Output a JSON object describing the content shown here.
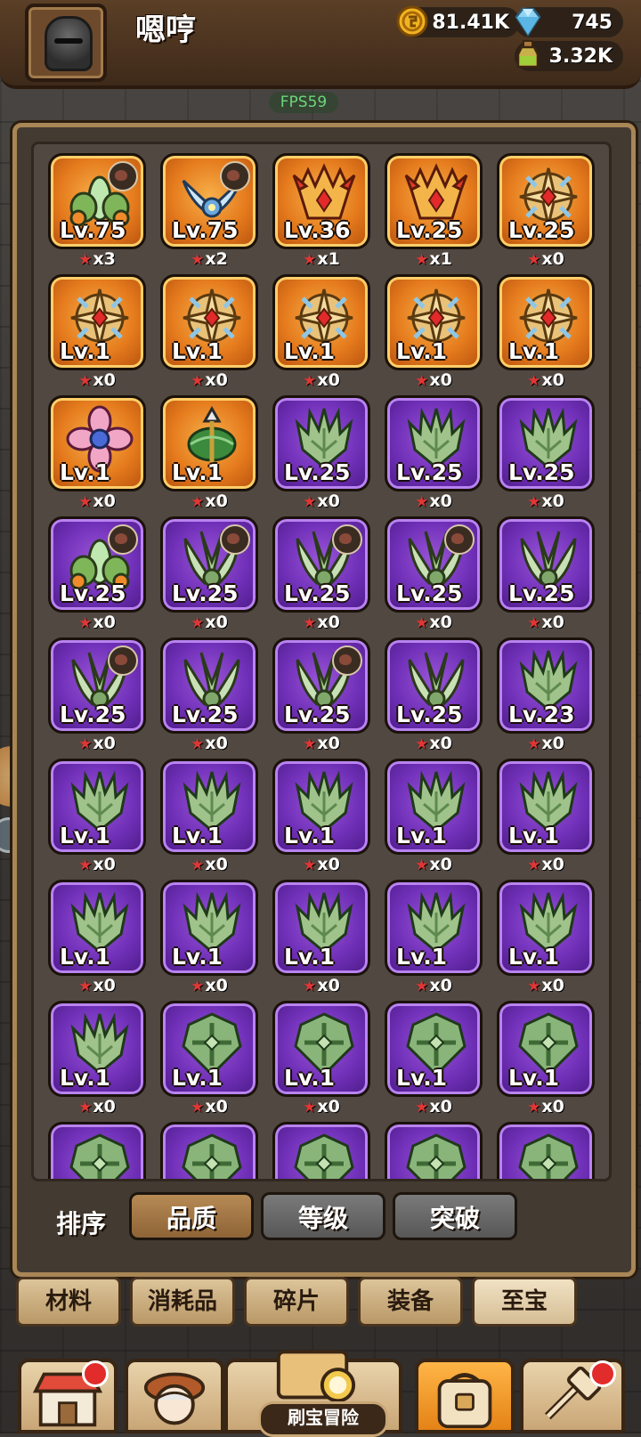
{
  "player": {
    "name": "嗯哼"
  },
  "resources": {
    "gold": "81.41K",
    "gems": "745",
    "potion": "3.32K"
  },
  "fps": "FPS59",
  "colors": {
    "legendary": "#e57b1d",
    "epic": "#7030b8",
    "star": "#e13636"
  },
  "items": [
    {
      "level": "Lv.75",
      "count": "x3",
      "rarity": "legendary",
      "art": "flower-green",
      "equipped": true
    },
    {
      "level": "Lv.75",
      "count": "x2",
      "rarity": "legendary",
      "art": "wings-blue",
      "equipped": true
    },
    {
      "level": "Lv.36",
      "count": "x1",
      "rarity": "legendary",
      "art": "demon-crown",
      "equipped": false
    },
    {
      "level": "Lv.25",
      "count": "x1",
      "rarity": "legendary",
      "art": "demon-crown",
      "equipped": false
    },
    {
      "level": "Lv.25",
      "count": "x0",
      "rarity": "legendary",
      "art": "cross-shield",
      "equipped": false
    },
    {
      "level": "Lv.1",
      "count": "x0",
      "rarity": "legendary",
      "art": "cross-shield",
      "equipped": false
    },
    {
      "level": "Lv.1",
      "count": "x0",
      "rarity": "legendary",
      "art": "cross-shield",
      "equipped": false
    },
    {
      "level": "Lv.1",
      "count": "x0",
      "rarity": "legendary",
      "art": "cross-shield",
      "equipped": false
    },
    {
      "level": "Lv.1",
      "count": "x0",
      "rarity": "legendary",
      "art": "cross-shield",
      "equipped": false
    },
    {
      "level": "Lv.1",
      "count": "x0",
      "rarity": "legendary",
      "art": "cross-shield",
      "equipped": false
    },
    {
      "level": "Lv.1",
      "count": "x0",
      "rarity": "legendary",
      "art": "pink-flower",
      "equipped": false
    },
    {
      "level": "Lv.1",
      "count": "x0",
      "rarity": "legendary",
      "art": "green-arrow",
      "equipped": false
    },
    {
      "level": "Lv.25",
      "count": "x0",
      "rarity": "epic",
      "art": "green-claw",
      "equipped": false
    },
    {
      "level": "Lv.25",
      "count": "x0",
      "rarity": "epic",
      "art": "green-claw",
      "equipped": false
    },
    {
      "level": "Lv.25",
      "count": "x0",
      "rarity": "epic",
      "art": "green-claw",
      "equipped": false
    },
    {
      "level": "Lv.25",
      "count": "x0",
      "rarity": "epic",
      "art": "flower-green",
      "equipped": true
    },
    {
      "level": "Lv.25",
      "count": "x0",
      "rarity": "epic",
      "art": "green-wings",
      "equipped": true
    },
    {
      "level": "Lv.25",
      "count": "x0",
      "rarity": "epic",
      "art": "green-wings",
      "equipped": true
    },
    {
      "level": "Lv.25",
      "count": "x0",
      "rarity": "epic",
      "art": "green-wings",
      "equipped": true
    },
    {
      "level": "Lv.25",
      "count": "x0",
      "rarity": "epic",
      "art": "green-wings",
      "equipped": false
    },
    {
      "level": "Lv.25",
      "count": "x0",
      "rarity": "epic",
      "art": "green-wings",
      "equipped": true
    },
    {
      "level": "Lv.25",
      "count": "x0",
      "rarity": "epic",
      "art": "green-wings",
      "equipped": false
    },
    {
      "level": "Lv.25",
      "count": "x0",
      "rarity": "epic",
      "art": "green-wings",
      "equipped": true
    },
    {
      "level": "Lv.25",
      "count": "x0",
      "rarity": "epic",
      "art": "green-wings",
      "equipped": false
    },
    {
      "level": "Lv.23",
      "count": "x0",
      "rarity": "epic",
      "art": "green-claw",
      "equipped": false
    },
    {
      "level": "Lv.1",
      "count": "x0",
      "rarity": "epic",
      "art": "green-claw",
      "equipped": false
    },
    {
      "level": "Lv.1",
      "count": "x0",
      "rarity": "epic",
      "art": "green-claw",
      "equipped": false
    },
    {
      "level": "Lv.1",
      "count": "x0",
      "rarity": "epic",
      "art": "green-claw",
      "equipped": false
    },
    {
      "level": "Lv.1",
      "count": "x0",
      "rarity": "epic",
      "art": "green-claw",
      "equipped": false
    },
    {
      "level": "Lv.1",
      "count": "x0",
      "rarity": "epic",
      "art": "green-claw",
      "equipped": false
    },
    {
      "level": "Lv.1",
      "count": "x0",
      "rarity": "epic",
      "art": "green-claw",
      "equipped": false
    },
    {
      "level": "Lv.1",
      "count": "x0",
      "rarity": "epic",
      "art": "green-claw",
      "equipped": false
    },
    {
      "level": "Lv.1",
      "count": "x0",
      "rarity": "epic",
      "art": "green-claw",
      "equipped": false
    },
    {
      "level": "Lv.1",
      "count": "x0",
      "rarity": "epic",
      "art": "green-claw",
      "equipped": false
    },
    {
      "level": "Lv.1",
      "count": "x0",
      "rarity": "epic",
      "art": "green-claw",
      "equipped": false
    },
    {
      "level": "Lv.1",
      "count": "x0",
      "rarity": "epic",
      "art": "green-claw",
      "equipped": false
    },
    {
      "level": "Lv.1",
      "count": "x0",
      "rarity": "epic",
      "art": "green-shield",
      "equipped": false
    },
    {
      "level": "Lv.1",
      "count": "x0",
      "rarity": "epic",
      "art": "green-shield",
      "equipped": false
    },
    {
      "level": "Lv.1",
      "count": "x0",
      "rarity": "epic",
      "art": "green-shield",
      "equipped": false
    },
    {
      "level": "Lv.1",
      "count": "x0",
      "rarity": "epic",
      "art": "green-shield",
      "equipped": false
    },
    {
      "level": "",
      "count": "",
      "rarity": "epic",
      "art": "green-shield",
      "equipped": false
    },
    {
      "level": "",
      "count": "",
      "rarity": "epic",
      "art": "green-shield",
      "equipped": false
    },
    {
      "level": "",
      "count": "",
      "rarity": "epic",
      "art": "green-shield",
      "equipped": false
    },
    {
      "level": "",
      "count": "",
      "rarity": "epic",
      "art": "green-shield",
      "equipped": false
    },
    {
      "level": "",
      "count": "",
      "rarity": "epic",
      "art": "green-shield",
      "equipped": false
    }
  ],
  "sort": {
    "label": "排序",
    "options": [
      "品质",
      "等级",
      "突破"
    ],
    "active": "品质"
  },
  "categories": {
    "tabs": [
      "材料",
      "消耗品",
      "碎片",
      "装备",
      "至宝"
    ],
    "active": "至宝"
  },
  "bottom_nav": {
    "items": [
      "shop-icon",
      "hero-icon",
      "adventure-map-icon",
      "bag-icon",
      "forge-icon"
    ],
    "center_label": "刷宝冒险",
    "active": "bag-icon"
  }
}
